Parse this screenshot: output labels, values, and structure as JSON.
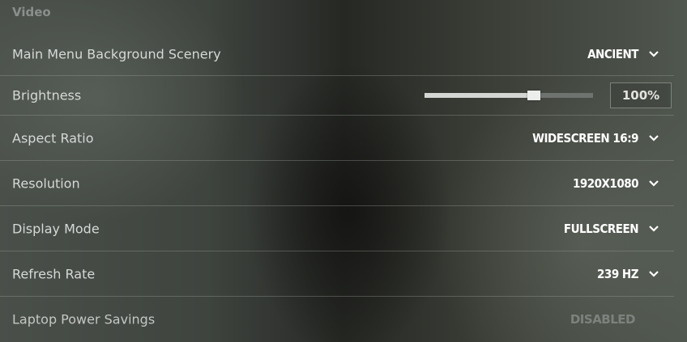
{
  "section": {
    "title": "Video"
  },
  "settings": [
    {
      "label": "Main Menu Background Scenery",
      "value": "ANCIENT"
    },
    {
      "label": "Brightness",
      "value": "100%",
      "slider_fraction": 0.65
    },
    {
      "label": "Aspect Ratio",
      "value": "WIDESCREEN 16:9"
    },
    {
      "label": "Resolution",
      "value": "1920X1080"
    },
    {
      "label": "Display Mode",
      "value": "FULLSCREEN"
    },
    {
      "label": "Refresh Rate",
      "value": "239 HZ"
    },
    {
      "label": "Laptop Power Savings",
      "value": "DISABLED",
      "disabled": true
    }
  ],
  "icons": {
    "dropdown": "chevron-down-icon"
  },
  "colors": {
    "text": "#d6d9d6",
    "value": "#ffffff",
    "disabled": "#7d827e",
    "divider": "#a0a59e"
  }
}
